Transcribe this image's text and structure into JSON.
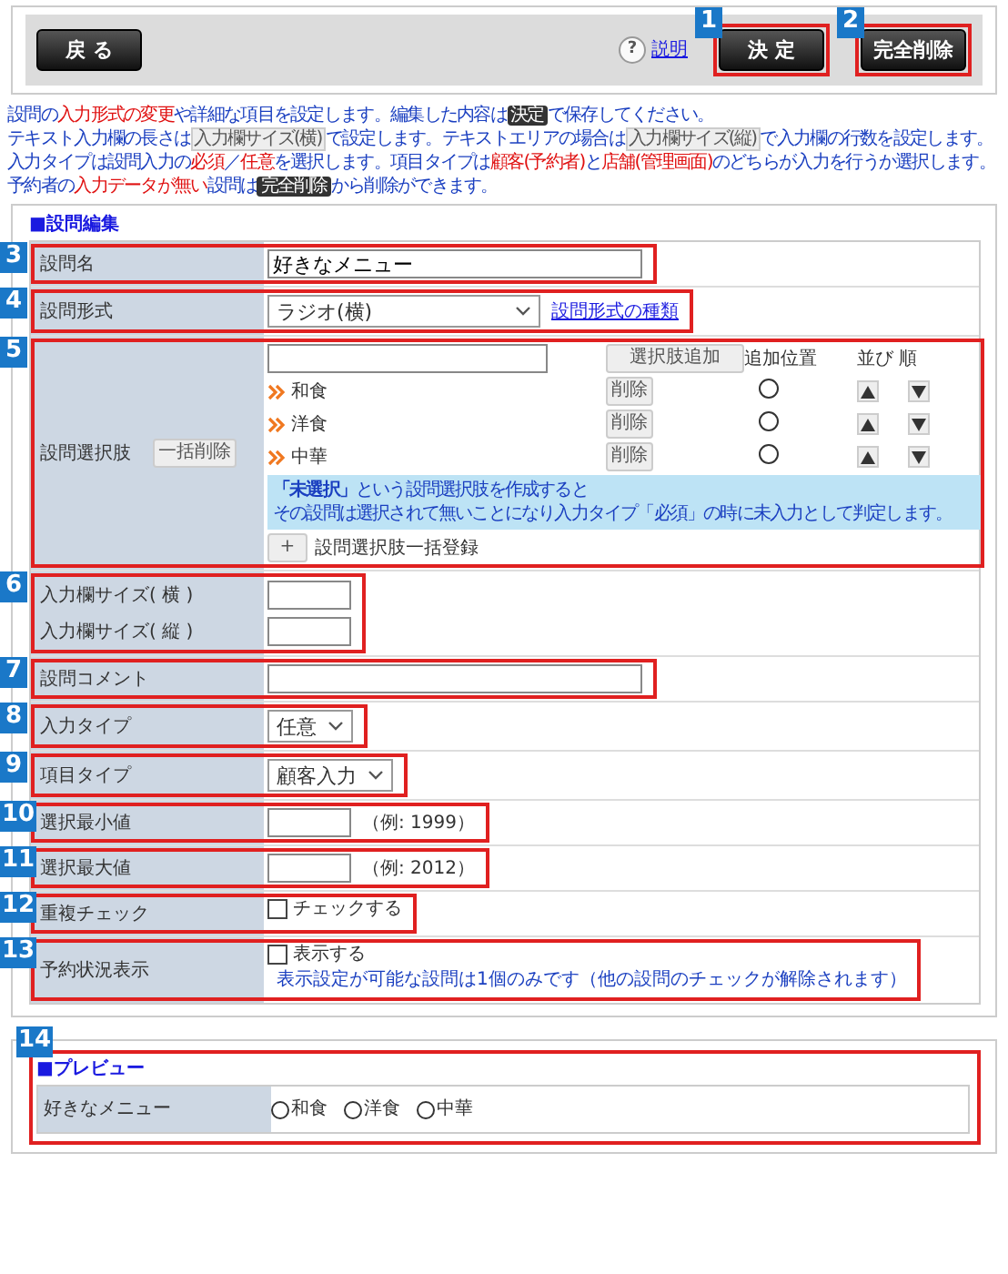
{
  "toolbar": {
    "back_button": "戻 る",
    "help_icon": "?",
    "help_link": "説明",
    "buttons": [
      {
        "label": "決 定",
        "callout": "1"
      },
      {
        "label": "完全削除",
        "callout": "2"
      }
    ]
  },
  "intro": [
    [
      {
        "kind": "text",
        "text": "設問の"
      },
      {
        "kind": "em",
        "text": "入力形式の変更"
      },
      {
        "kind": "text",
        "text": "や詳細な項目を設定します。編集した内容は"
      },
      {
        "kind": "key",
        "text": "決定"
      },
      {
        "kind": "text",
        "text": "で保存してください。"
      }
    ],
    [
      {
        "kind": "text",
        "text": "テキスト入力欄の長さは"
      },
      {
        "kind": "chip",
        "text": "入力欄サイズ(横)"
      },
      {
        "kind": "text",
        "text": "で設定します。テキストエリアの場合は"
      },
      {
        "kind": "chip",
        "text": "入力欄サイズ(縦)"
      },
      {
        "kind": "text",
        "text": "で入力欄の行数を設定します。"
      }
    ],
    [
      {
        "kind": "text",
        "text": "入力タイプは設問入力の"
      },
      {
        "kind": "em",
        "text": "必須"
      },
      {
        "kind": "text",
        "text": "／"
      },
      {
        "kind": "em",
        "text": "任意"
      },
      {
        "kind": "text",
        "text": "を選択します。項目タイプは"
      },
      {
        "kind": "em",
        "text": "顧客(予約者)"
      },
      {
        "kind": "text",
        "text": "と"
      },
      {
        "kind": "em",
        "text": "店舗(管理画面)"
      },
      {
        "kind": "text",
        "text": "のどちらが入力を行うか選択します。"
      }
    ],
    [
      {
        "kind": "text",
        "text": "予約者の"
      },
      {
        "kind": "em",
        "text": "入力データが無い"
      },
      {
        "kind": "text",
        "text": "設問は"
      },
      {
        "kind": "key",
        "text": "完全削除"
      },
      {
        "kind": "text",
        "text": "から削除ができます。"
      }
    ]
  ],
  "editor": {
    "title": "■設問編集",
    "rows": [
      {
        "kind": "text",
        "callout": "3",
        "label": "設問名",
        "value": "好きなメニュー"
      },
      {
        "kind": "select",
        "callout": "4",
        "label": "設問形式",
        "value": "ラジオ(横)",
        "link": "設問形式の種類"
      },
      {
        "kind": "choices",
        "callout": "5",
        "label": "設問選択肢",
        "bulk_delete": "一括削除",
        "add_button": "選択肢追加",
        "position_heading": "追加位置",
        "order_heading": "並び 順",
        "items": [
          {
            "label": "和食",
            "delete": "削除",
            "selected": false
          },
          {
            "label": "洋食",
            "delete": "削除",
            "selected": false
          },
          {
            "label": "中華",
            "delete": "削除",
            "selected": false
          }
        ],
        "note_lines": [
          "**「未選択」**という設問選択肢を作成すると",
          "その設問は選択されて無いことになり入力タイプ「必須」の時に未入力として判定します。"
        ],
        "plus_button": "+",
        "bulk_register": "設問選択肢一括登録"
      },
      {
        "kind": "size_pair",
        "callout": "6",
        "fields": [
          {
            "label": "入力欄サイズ( 横 )"
          },
          {
            "label": "入力欄サイズ( 縦 )"
          }
        ]
      },
      {
        "kind": "text",
        "callout": "7",
        "label": "設問コメント"
      },
      {
        "kind": "select",
        "callout": "8",
        "label": "入力タイプ",
        "value": "任意"
      },
      {
        "kind": "select",
        "callout": "9",
        "label": "項目タイプ",
        "value": "顧客入力"
      },
      {
        "kind": "short_text",
        "callout": "10",
        "label": "選択最小値",
        "hint": "（例: 1999）"
      },
      {
        "kind": "short_text",
        "callout": "11",
        "label": "選択最大値",
        "hint": "（例: 2012）"
      },
      {
        "kind": "checkbox",
        "callout": "12",
        "label": "重複チェック",
        "option": "チェックする",
        "checked": false
      },
      {
        "kind": "checkbox",
        "callout": "13",
        "label": "予約状況表示",
        "option": "表示する",
        "checked": false,
        "note": "表示設定が可能な設問は1個のみです（他の設問のチェックが解除されます）"
      }
    ]
  },
  "preview": {
    "callout": "14",
    "title": "■プレビュー",
    "label": "好きなメニュー",
    "options": [
      {
        "label": "和食",
        "selected": false
      },
      {
        "label": "洋食",
        "selected": false
      },
      {
        "label": "中華",
        "selected": false
      }
    ]
  }
}
